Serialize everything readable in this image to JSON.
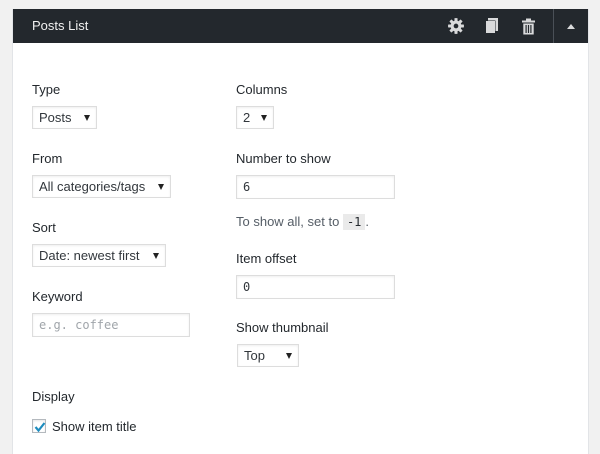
{
  "header": {
    "title": "Posts List",
    "icons": {
      "settings": "gear-icon",
      "duplicate": "copy-icon",
      "delete": "trash-icon",
      "collapse": "triangle-up-icon"
    }
  },
  "form": {
    "type": {
      "label": "Type",
      "value": "Posts"
    },
    "from": {
      "label": "From",
      "value": "All categories/tags"
    },
    "sort": {
      "label": "Sort",
      "value": "Date: newest first"
    },
    "keyword": {
      "label": "Keyword",
      "value": "",
      "placeholder": "e.g. coffee"
    },
    "display": {
      "label": "Display"
    },
    "show_item_title": {
      "label": "Show item title",
      "checked": true
    },
    "columns": {
      "label": "Columns",
      "value": "2"
    },
    "number_to_show": {
      "label": "Number to show",
      "value": "6",
      "help_prefix": "To show all, set to",
      "help_code": "-1",
      "help_suffix": "."
    },
    "item_offset": {
      "label": "Item offset",
      "value": "0"
    },
    "show_thumbnail": {
      "label": "Show thumbnail",
      "value": "Top"
    }
  },
  "colors": {
    "header_bg": "#23282d",
    "checkbox_check": "#1e8cbe"
  }
}
